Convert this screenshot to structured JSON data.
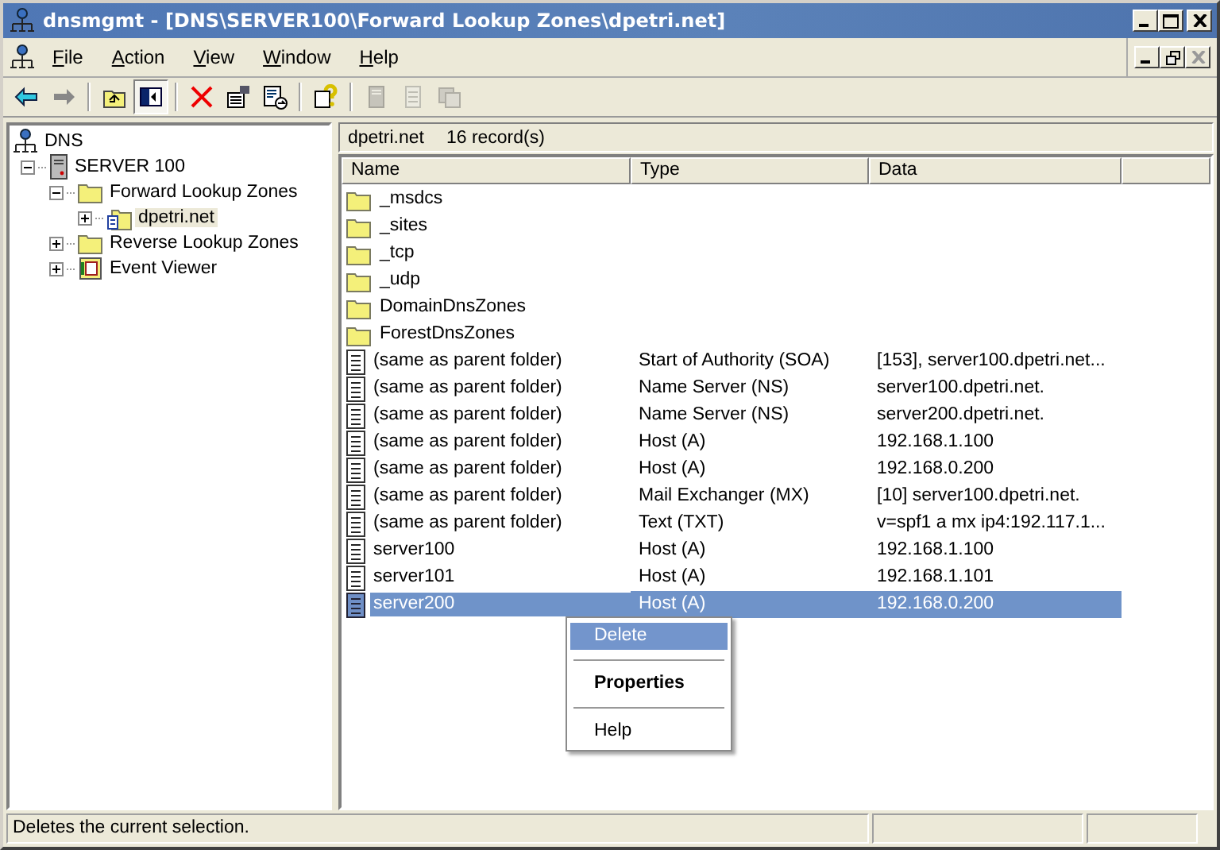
{
  "window": {
    "title": "dnsmgmt - [DNS\\SERVER100\\Forward Lookup Zones\\dpetri.net]"
  },
  "menu": [
    "File",
    "Action",
    "View",
    "Window",
    "Help"
  ],
  "toolbar": [
    {
      "kind": "back",
      "disabled": false,
      "pressed": false
    },
    {
      "kind": "forward",
      "disabled": false,
      "pressed": false
    },
    {
      "kind": "sep"
    },
    {
      "kind": "up",
      "disabled": false,
      "pressed": false
    },
    {
      "kind": "tree",
      "disabled": false,
      "pressed": true
    },
    {
      "kind": "sep"
    },
    {
      "kind": "delete",
      "disabled": false,
      "pressed": false
    },
    {
      "kind": "properties",
      "disabled": false,
      "pressed": false
    },
    {
      "kind": "export",
      "disabled": false,
      "pressed": false
    },
    {
      "kind": "sep"
    },
    {
      "kind": "help",
      "disabled": false,
      "pressed": false
    },
    {
      "kind": "sep"
    },
    {
      "kind": "record",
      "disabled": true,
      "pressed": false
    },
    {
      "kind": "note",
      "disabled": true,
      "pressed": false
    },
    {
      "kind": "stack",
      "disabled": true,
      "pressed": false
    }
  ],
  "tree": [
    {
      "label": "DNS",
      "kind": "dns",
      "selected": false,
      "children": [
        {
          "label": "SERVER 100",
          "kind": "server",
          "expanded": true,
          "selected": false,
          "children": [
            {
              "label": "Forward Lookup Zones",
              "kind": "folder",
              "expanded": true,
              "selected": false,
              "children": [
                {
                  "label": "dpetri.net",
                  "kind": "zone",
                  "expanded": false,
                  "selected": true
                }
              ]
            },
            {
              "label": "Reverse Lookup Zones",
              "kind": "folder",
              "expanded": false,
              "selected": false
            },
            {
              "label": "Event Viewer",
              "kind": "event",
              "expanded": false,
              "selected": false
            }
          ]
        }
      ]
    }
  ],
  "pane_header": {
    "zone": "dpetri.net",
    "count": "16 record(s)"
  },
  "table": {
    "columns": [
      "Name",
      "Type",
      "Data"
    ],
    "rows": [
      {
        "kind": "folder",
        "name": "_msdcs",
        "selected": false
      },
      {
        "kind": "folder",
        "name": "_sites",
        "selected": false
      },
      {
        "kind": "folder",
        "name": "_tcp",
        "selected": false
      },
      {
        "kind": "folder",
        "name": "_udp",
        "selected": false
      },
      {
        "kind": "folder",
        "name": "DomainDnsZones",
        "selected": false
      },
      {
        "kind": "folder",
        "name": "ForestDnsZones",
        "selected": false
      },
      {
        "kind": "record",
        "name": "(same as parent folder)",
        "type": "Start of Authority (SOA)",
        "data": "[153], server100.dpetri.net...",
        "selected": false
      },
      {
        "kind": "record",
        "name": "(same as parent folder)",
        "type": "Name Server (NS)",
        "data": "server100.dpetri.net.",
        "selected": false
      },
      {
        "kind": "record",
        "name": "(same as parent folder)",
        "type": "Name Server (NS)",
        "data": "server200.dpetri.net.",
        "selected": false
      },
      {
        "kind": "record",
        "name": "(same as parent folder)",
        "type": "Host (A)",
        "data": "192.168.1.100",
        "selected": false
      },
      {
        "kind": "record",
        "name": "(same as parent folder)",
        "type": "Host (A)",
        "data": "192.168.0.200",
        "selected": false
      },
      {
        "kind": "record",
        "name": "(same as parent folder)",
        "type": "Mail Exchanger (MX)",
        "data": "[10]  server100.dpetri.net.",
        "selected": false
      },
      {
        "kind": "record",
        "name": "(same as parent folder)",
        "type": "Text (TXT)",
        "data": "v=spf1 a mx ip4:192.117.1...",
        "selected": false
      },
      {
        "kind": "record",
        "name": "server100",
        "type": "Host (A)",
        "data": "192.168.1.100",
        "selected": false
      },
      {
        "kind": "record",
        "name": "server101",
        "type": "Host (A)",
        "data": "192.168.1.101",
        "selected": false
      },
      {
        "kind": "record",
        "name": "server200",
        "type": "Host (A)",
        "data": "192.168.0.200",
        "selected": true
      }
    ]
  },
  "context_menu": [
    {
      "kind": "item",
      "label": "Delete",
      "bold": false,
      "selected": true
    },
    {
      "kind": "sep"
    },
    {
      "kind": "item",
      "label": "Properties",
      "bold": true,
      "selected": false
    },
    {
      "kind": "sep"
    },
    {
      "kind": "item",
      "label": "Help",
      "bold": false,
      "selected": false
    }
  ],
  "status_bar": {
    "text": "Deletes the current selection."
  }
}
